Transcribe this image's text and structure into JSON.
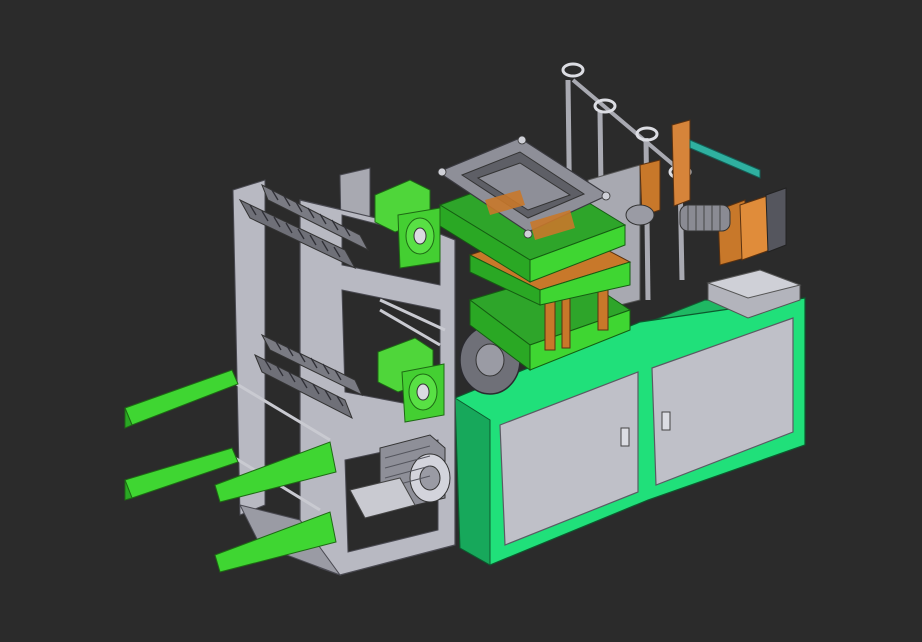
{
  "scene": {
    "subject": "packaging-machine-3d-cad-model",
    "background": "#2b2b2b",
    "colors": {
      "frame_gray": "#b8b9c2",
      "frame_gray_dark": "#8e8f98",
      "frame_gray_light": "#d3d4dc",
      "cabinet_green": "#20e07a",
      "bright_green": "#3fd632",
      "bright_green_dark": "#2aa824",
      "motor_green": "#4fd63a",
      "orange": "#c8782a",
      "orange_light": "#e08c3a",
      "steel": "#9a9ba4",
      "roller": "#6f7078",
      "door_gray": "#bfc0c8",
      "dark_steel": "#55565e"
    }
  }
}
